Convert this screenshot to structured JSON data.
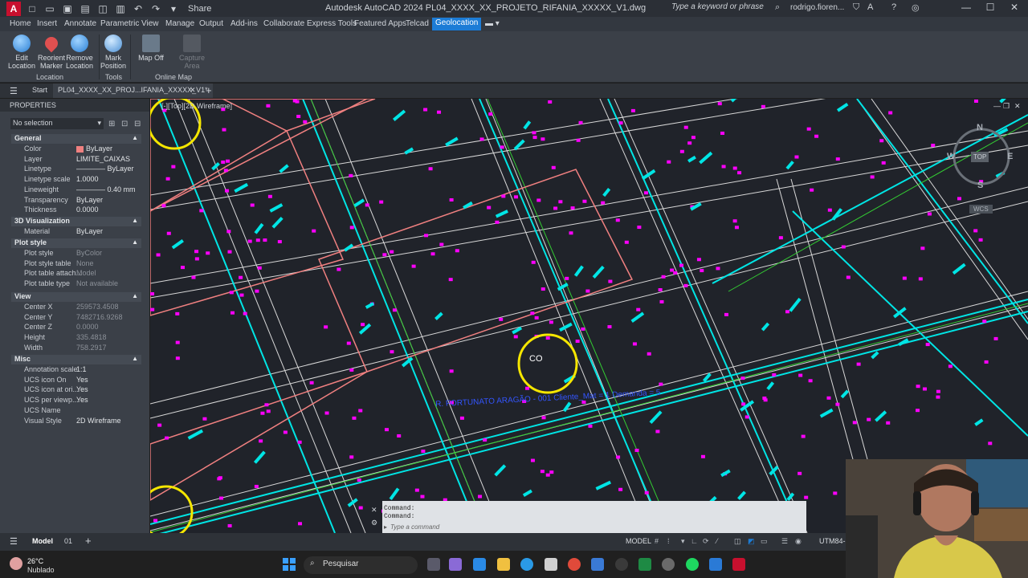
{
  "titlebar": {
    "app_name": "A",
    "share_label": "Share",
    "title": "Autodesk AutoCAD 2024   PL04_XXXX_XX_PROJETO_RIFANIA_XXXXX_V1.dwg",
    "search_placeholder": "Type a keyword or phrase",
    "user": "rodrigo.fioren..."
  },
  "ribbon_tabs": [
    "Home",
    "Insert",
    "Annotate",
    "Parametric",
    "View",
    "Manage",
    "Output",
    "Add-ins",
    "Collaborate",
    "Express Tools",
    "Featured Apps",
    "Telcad",
    "Geolocation"
  ],
  "ribbon": {
    "buttons": {
      "edit_location": "Edit\nLocation",
      "reorient_marker": "Reorient\nMarker",
      "remove_location": "Remove\nLocation",
      "mark_position": "Mark\nPosition",
      "map_off": "Map Off",
      "capture_area": "Capture\nArea"
    },
    "groups": {
      "location": "Location",
      "tools": "Tools",
      "online_map": "Online Map"
    }
  },
  "file_tabs": {
    "start": "Start",
    "active": "PL04_XXXX_XX_PROJ...IFANIA_XXXXX_V1*"
  },
  "properties": {
    "title": "PROPERTIES",
    "selection": "No selection",
    "sections": {
      "general": "General",
      "visualization": "3D Visualization",
      "plot_style": "Plot style",
      "view": "View",
      "misc": "Misc"
    },
    "general": [
      {
        "k": "Color",
        "v": "ByLayer"
      },
      {
        "k": "Layer",
        "v": "LIMITE_CAIXAS"
      },
      {
        "k": "Linetype",
        "v": "———— ByLayer"
      },
      {
        "k": "Linetype scale",
        "v": "1.0000"
      },
      {
        "k": "Lineweight",
        "v": "———— 0.40 mm"
      },
      {
        "k": "Transparency",
        "v": "ByLayer"
      },
      {
        "k": "Thickness",
        "v": "0.0000"
      }
    ],
    "visualization": [
      {
        "k": "Material",
        "v": "ByLayer"
      }
    ],
    "plot": [
      {
        "k": "Plot style",
        "v": "ByColor"
      },
      {
        "k": "Plot style table",
        "v": "None"
      },
      {
        "k": "Plot table attach...",
        "v": "Model"
      },
      {
        "k": "Plot table type",
        "v": "Not available"
      }
    ],
    "view": [
      {
        "k": "Center X",
        "v": "259573.4508"
      },
      {
        "k": "Center Y",
        "v": "7482716.9268"
      },
      {
        "k": "Center Z",
        "v": "0.0000"
      },
      {
        "k": "Height",
        "v": "335.4818"
      },
      {
        "k": "Width",
        "v": "758.2917"
      }
    ],
    "misc": [
      {
        "k": "Annotation scale",
        "v": "1:1"
      },
      {
        "k": "UCS icon On",
        "v": "Yes"
      },
      {
        "k": "UCS icon at ori...",
        "v": "Yes"
      },
      {
        "k": "UCS per viewp...",
        "v": "Yes"
      },
      {
        "k": "UCS Name",
        "v": ""
      },
      {
        "k": "Visual Style",
        "v": "2D Wireframe"
      }
    ]
  },
  "drawing": {
    "viewport_label": "[-][Top][2D Wireframe]",
    "compass": {
      "n": "N",
      "s": "S",
      "e": "E",
      "w": "W",
      "top": "TOP"
    },
    "wcs": "WCS",
    "highlight_label": "CO",
    "annotation_blue": "R. FORTUNATO ARAGÃO - 001 Cliente_Mat = 1  Demanda = 5"
  },
  "command": {
    "hist1": "Command:",
    "hist2": "Command:",
    "placeholder": "Type a command"
  },
  "statusbar": {
    "model_tab": "Model",
    "layout_tab": "01",
    "model_btn": "MODEL",
    "coord": "UTM84-"
  },
  "taskbar": {
    "temp": "26°C",
    "weather": "Nublado",
    "search": "Pesquisar"
  },
  "colors": {
    "accent": "#1c7cd6",
    "cyan": "#00e5e5",
    "magenta": "#ff00ff",
    "pink_boundary": "#f08080",
    "green": "#33cc33",
    "highlight_ring": "#f5e600"
  }
}
